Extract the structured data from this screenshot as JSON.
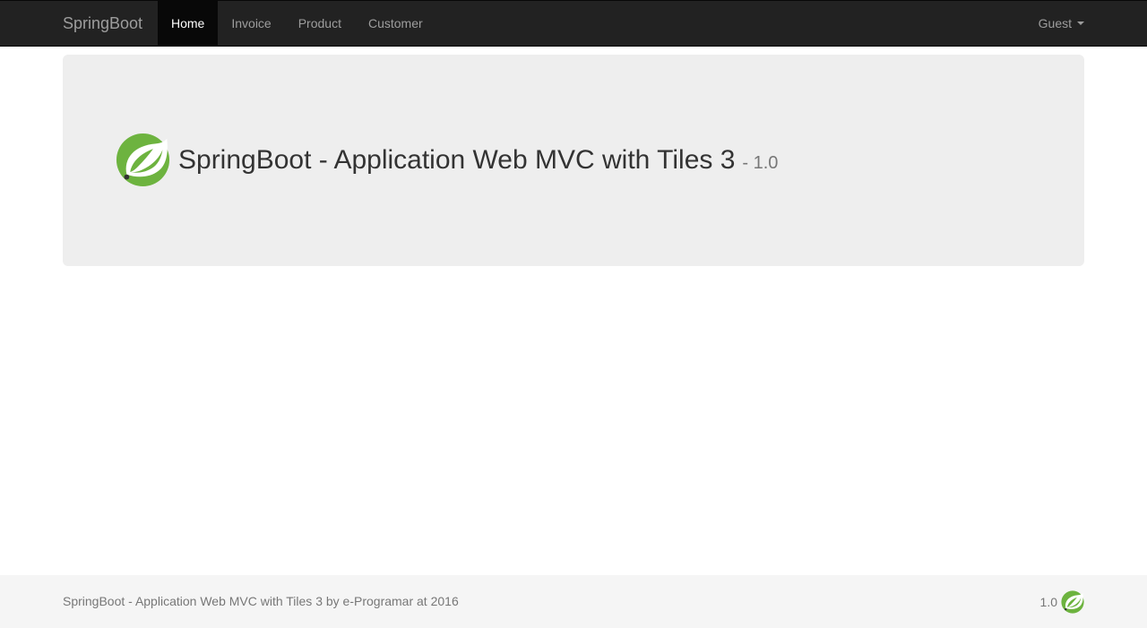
{
  "navbar": {
    "brand": "SpringBoot",
    "items": [
      {
        "label": "Home",
        "active": true
      },
      {
        "label": "Invoice",
        "active": false
      },
      {
        "label": "Product",
        "active": false
      },
      {
        "label": "Customer",
        "active": false
      }
    ],
    "user_menu": {
      "label": "Guest",
      "icon": "caret-down-icon"
    }
  },
  "hero": {
    "logo_icon": "spring-leaf-logo",
    "title": "SpringBoot - Application Web MVC with Tiles 3",
    "version": "- 1.0"
  },
  "footer": {
    "text": "SpringBoot - Application Web MVC with Tiles 3 by e-Programar at 2016",
    "version": "1.0",
    "logo_icon": "spring-leaf-logo"
  },
  "colors": {
    "navbar_bg": "#222222",
    "nav_active_bg": "#080808",
    "jumbotron_bg": "#eeeeee",
    "footer_bg": "#f5f5f5",
    "spring_green": "#6db33f"
  }
}
